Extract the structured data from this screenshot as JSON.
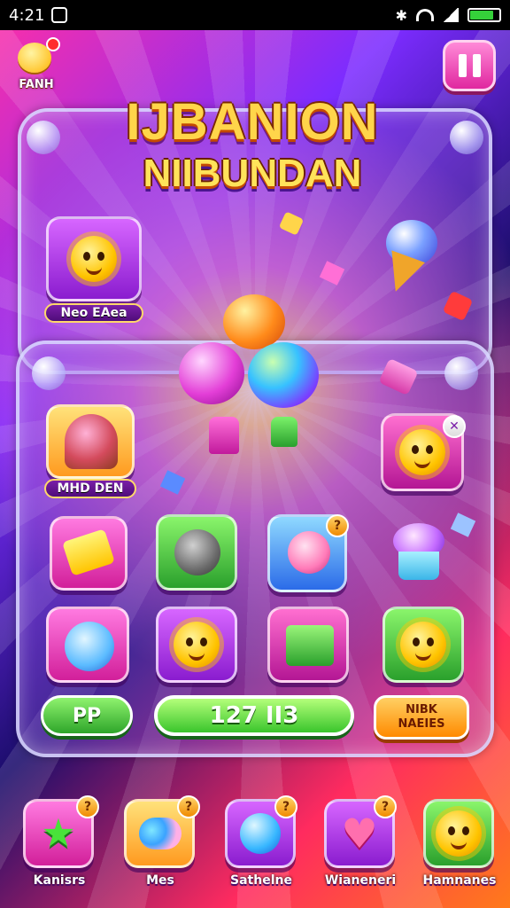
{
  "status_bar": {
    "time": "4:21"
  },
  "corner_badge": {
    "label": "FANH"
  },
  "title": {
    "line1": "IJBANION",
    "line2": "NIIBUNDAN"
  },
  "grid": {
    "tile_label_1": "Neo EAea",
    "tile_label_2": "MHD DEN"
  },
  "buttons": {
    "left": "PP",
    "score": "127 II3",
    "right_line1": "NIBK",
    "right_line2": "NAEIES"
  },
  "bottom_nav": {
    "items": [
      {
        "label": "Kanisrs",
        "icon": "star-icon"
      },
      {
        "label": "Mes",
        "icon": "candy-icon"
      },
      {
        "label": "Sathelne",
        "icon": "orb-icon"
      },
      {
        "label": "Wianeneri",
        "icon": "heart-icon"
      },
      {
        "label": "Hamnanes",
        "icon": "cat-face-icon"
      }
    ]
  },
  "colors": {
    "accent_pink": "#ff4fc1",
    "accent_green": "#3ac52c",
    "accent_orange": "#ff8a00",
    "title_yellow": "#ffd54a"
  }
}
